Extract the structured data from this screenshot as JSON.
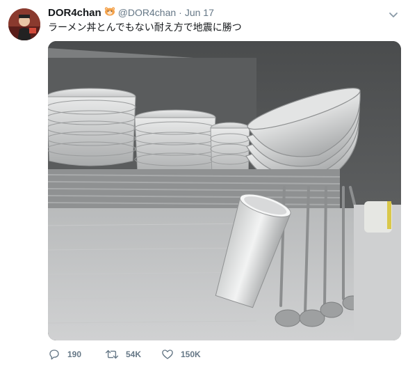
{
  "tweet": {
    "display_name": "DOR4chan",
    "badge_icon": "hamster-emoji-icon",
    "handle": "@DOR4chan",
    "separator": "·",
    "date": "Jun 17",
    "text": "ラーメン丼とんでもない耐え方で地震に勝つ",
    "media_icon": "photo-of-stacked-ramen-bowls-on-shelf"
  },
  "actions": {
    "reply_count": "190",
    "retweet_count": "54K",
    "like_count": "150K"
  },
  "colors": {
    "text": "#14171a",
    "secondary": "#657786"
  }
}
